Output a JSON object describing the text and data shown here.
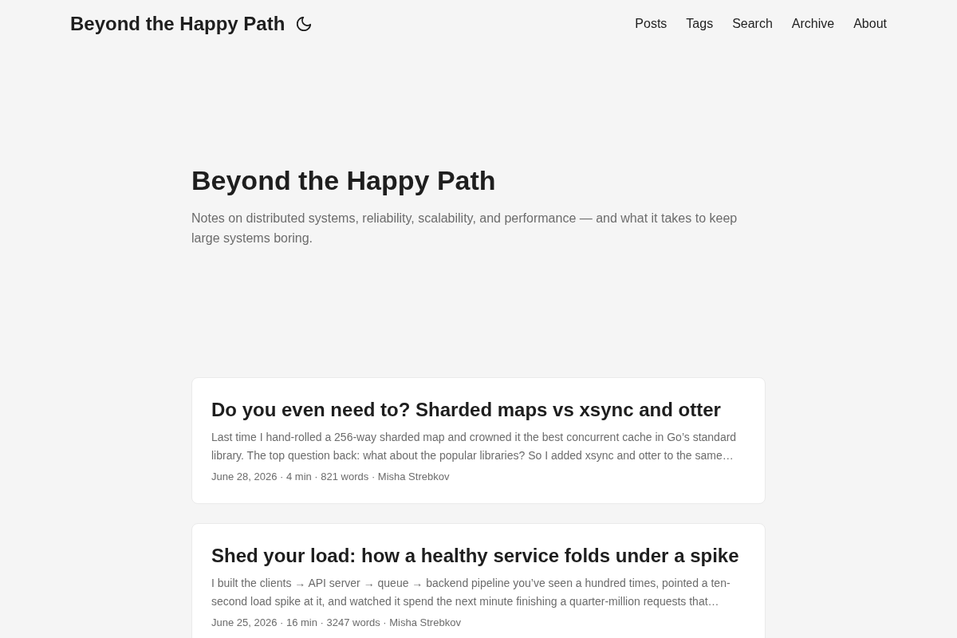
{
  "header": {
    "logo": "Beyond the Happy Path",
    "menu": [
      {
        "label": "Posts"
      },
      {
        "label": "Tags"
      },
      {
        "label": "Search"
      },
      {
        "label": "Archive"
      },
      {
        "label": "About"
      }
    ]
  },
  "hero": {
    "title": "Beyond the Happy Path",
    "description": "Notes on distributed systems, reliability, scalability, and performance — and what it takes to keep large systems boring."
  },
  "posts": [
    {
      "title": "Do you even need to? Sharded maps vs xsync and otter",
      "summary": "Last time I hand-rolled a 256-way sharded map and crowned it the best concurrent cache in Go’s standard library. The top question back: what about the popular libraries? So I added xsync and otter to the same…",
      "meta": "June 28, 2026 · 4 min · 821 words · Misha Strebkov"
    },
    {
      "title": "Shed your load: how a healthy service folds under a spike",
      "summary": "I built the clients → API server → queue → backend pipeline you’ve seen a hundred times, pointed a ten-second load spike at it, and watched it spend the next minute finishing a quarter-million requests that…",
      "meta": "June 25, 2026 · 16 min · 3247 words · Misha Strebkov"
    }
  ]
}
